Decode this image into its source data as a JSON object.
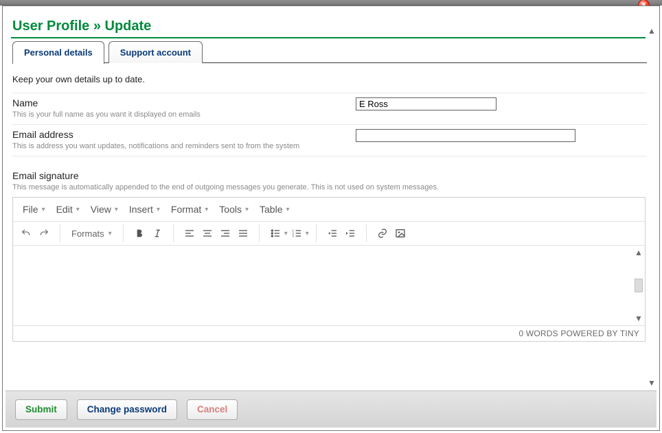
{
  "header": {
    "title_main": "User Profile",
    "title_sep": "»",
    "title_sub": "Update"
  },
  "tabs": [
    {
      "label": "Personal details",
      "active": true
    },
    {
      "label": "Support account",
      "active": false
    }
  ],
  "intro": "Keep your own details up to date.",
  "fields": {
    "name": {
      "label": "Name",
      "help": "This is your full name as you want it displayed on emails",
      "value": "E Ross"
    },
    "email": {
      "label": "Email address",
      "help": "This is address you want updates, notifications and reminders sent to from the system",
      "value": ""
    }
  },
  "signature": {
    "label": "Email signature",
    "help": "This message is automatically appended to the end of outgoing messages you generate. This is not used on system messages."
  },
  "editor": {
    "menus": [
      "File",
      "Edit",
      "View",
      "Insert",
      "Format",
      "Tools",
      "Table"
    ],
    "formats_label": "Formats",
    "status": "0 WORDS POWERED BY TINY"
  },
  "footer": {
    "submit": "Submit",
    "change_password": "Change password",
    "cancel": "Cancel"
  },
  "icons": {
    "close_glyph": "✕"
  }
}
